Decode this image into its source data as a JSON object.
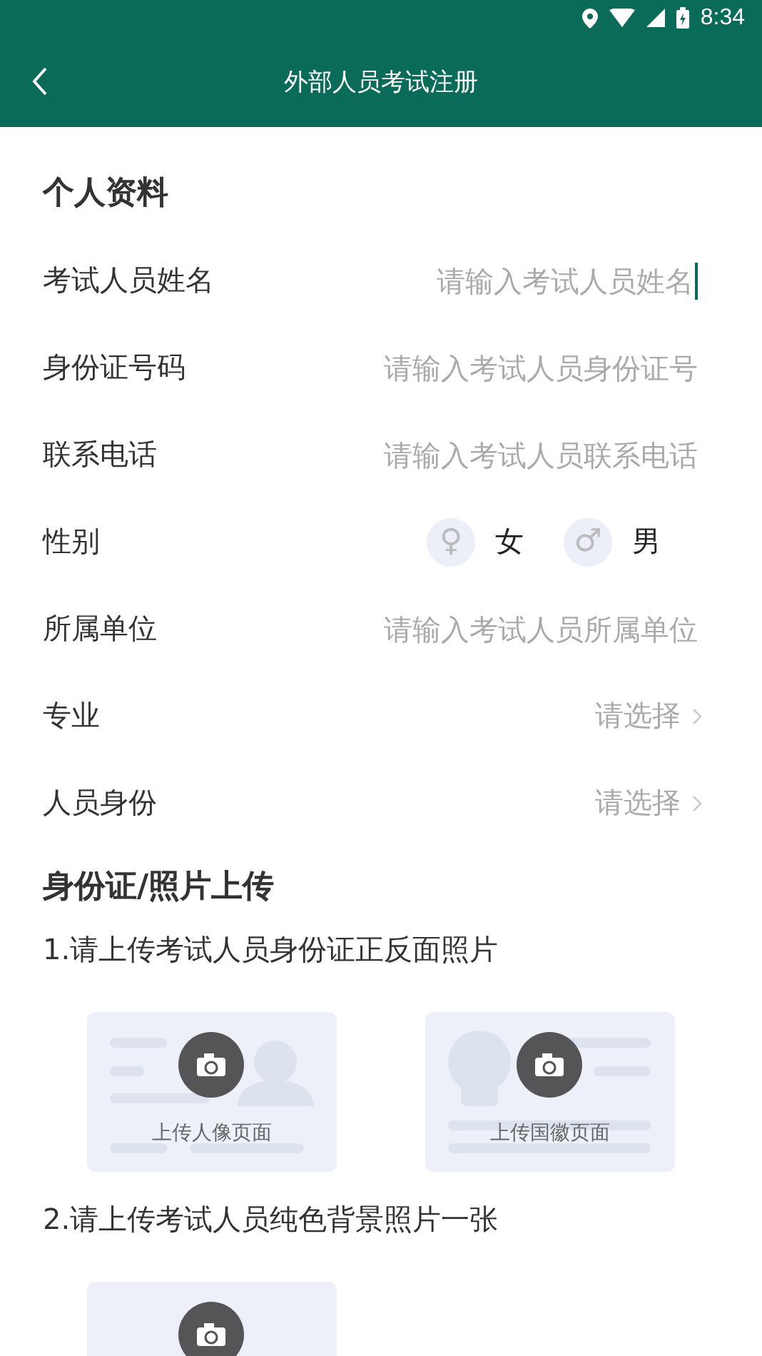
{
  "status_bar": {
    "time": "8:34"
  },
  "header": {
    "title": "外部人员考试注册"
  },
  "personal": {
    "title": "个人资料",
    "fields": [
      {
        "kind": "input",
        "label": "考试人员姓名",
        "placeholder": "请输入考试人员姓名",
        "focused": true
      },
      {
        "kind": "input",
        "label": "身份证号码",
        "placeholder": "请输入考试人员身份证号",
        "focused": false
      },
      {
        "kind": "input",
        "label": "联系电话",
        "placeholder": "请输入考试人员联系电话",
        "focused": false
      },
      {
        "kind": "gender",
        "label": "性别",
        "options": [
          {
            "label": "女",
            "symbol": "♀",
            "selected": false
          },
          {
            "label": "男",
            "symbol": "♂",
            "selected": false
          }
        ]
      },
      {
        "kind": "input",
        "label": "所属单位",
        "placeholder": "请输入考试人员所属单位",
        "focused": false
      },
      {
        "kind": "select",
        "label": "专业",
        "value": "请选择"
      },
      {
        "kind": "select",
        "label": "人员身份",
        "value": "请选择"
      }
    ]
  },
  "upload": {
    "title": "身份证/照片上传",
    "steps": [
      {
        "text": "1.请上传考试人员身份证正反面照片",
        "cards": [
          {
            "kind": "id-front",
            "label": "上传人像页面"
          },
          {
            "kind": "id-back",
            "label": "上传国徽页面"
          }
        ]
      },
      {
        "text": "2.请上传考试人员纯色背景照片一张",
        "cards": [
          {
            "kind": "photo"
          }
        ]
      }
    ]
  }
}
